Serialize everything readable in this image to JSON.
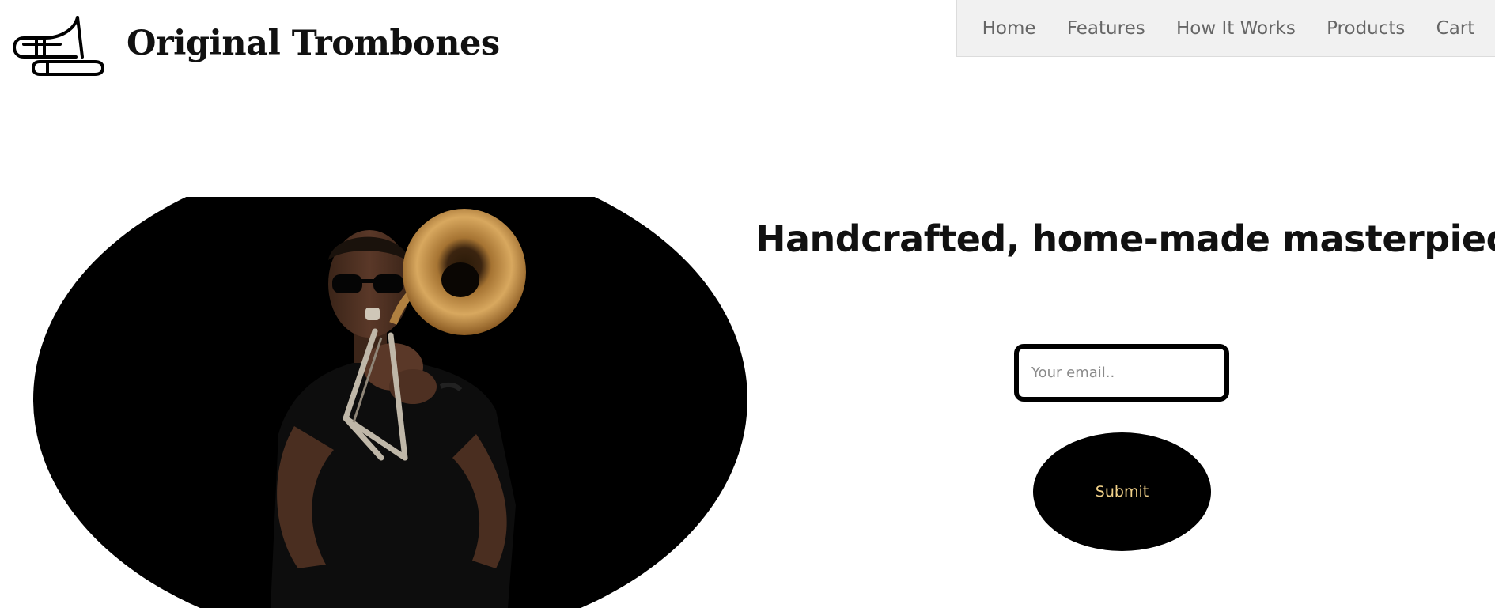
{
  "brand": {
    "name": "Original Trombones",
    "logo_icon": "trombone-icon"
  },
  "nav": {
    "items": [
      {
        "label": "Home"
      },
      {
        "label": "Features"
      },
      {
        "label": "How It Works"
      },
      {
        "label": "Products"
      },
      {
        "label": "Cart"
      }
    ]
  },
  "hero": {
    "video_subject": "trombone player video",
    "headline": "Handcrafted, home-made masterpieces"
  },
  "form": {
    "email_placeholder": "Your email..",
    "email_value": "",
    "submit_label": "Submit"
  },
  "colors": {
    "nav_background": "#f1f1f1",
    "nav_text": "#666666",
    "submit_background": "#000000",
    "submit_text": "#f2d28a"
  }
}
